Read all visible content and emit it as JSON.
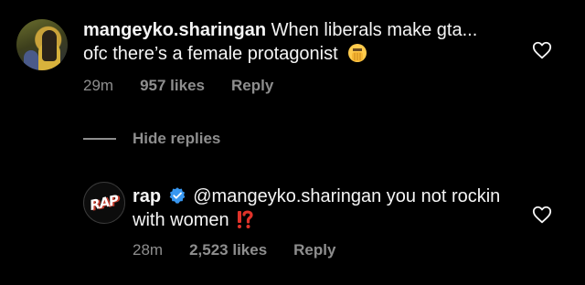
{
  "comments": [
    {
      "username": "mangeyko.sharingan",
      "text": "When liberals make gta... ofc there’s a female protagonist",
      "emoji": "🤦‍♂️",
      "time": "29m",
      "likes": "957 likes",
      "reply_label": "Reply"
    },
    {
      "username": "rap",
      "verified": true,
      "text": "@mangeyko.sharingan you not rockin with women",
      "emoji": "⁉️",
      "time": "28m",
      "likes": "2,523 likes",
      "reply_label": "Reply"
    }
  ],
  "hide_replies_label": "Hide replies",
  "avatar2_logo_text": "RAP",
  "icons": {
    "like": "heart-outline-icon",
    "verified": "verified-badge-icon",
    "facepalm": "man-facepalming-emoji",
    "interrobang": "exclamation-question-emoji"
  },
  "colors": {
    "background": "#000000",
    "text": "#f5f5f5",
    "muted": "#8e8e8e",
    "verified": "#3897f0",
    "alert_red": "#e0332a"
  }
}
